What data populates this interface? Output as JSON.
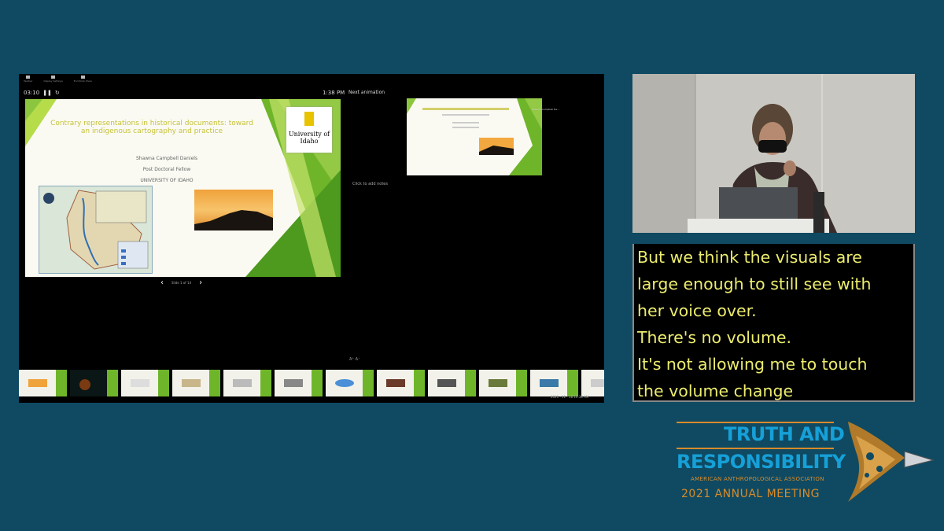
{
  "presenter": {
    "toolbar": [
      {
        "label": "Taskbar",
        "icon": "taskbar-icon"
      },
      {
        "label": "Display Settings",
        "icon": "display-settings-icon"
      },
      {
        "label": "End Slide Show",
        "icon": "end-slideshow-icon"
      }
    ],
    "timer": "03:10",
    "clock": "1:38 PM",
    "next_animation_label": "Next animation",
    "notes_placeholder": "Click to add notes",
    "slide_counter": "Slide 1 of 14",
    "prev_glyph": "‹",
    "next_glyph": "›",
    "font_adjust": "A⁺  A⁻",
    "next_slide_caption": "Shawna Campbell Da...",
    "status_text": "2021 · 11 · 18  10:38 AM"
  },
  "current_slide": {
    "title": "Contrary representations in historical documents: toward an indigenous cartography and practice",
    "author_lines": [
      "Shawna Campbell Daniels",
      "Post Doctoral Fellow",
      "UNIVERSITY OF IDAHO"
    ],
    "logo_text": "University of Idaho"
  },
  "captions": {
    "lines": [
      "But we think the visuals are",
      "large enough to still see with",
      "her voice over.",
      "There's no volume.",
      "It's not allowing me to touch",
      "the volume change"
    ]
  },
  "logo": {
    "line1": "TRUTH AND",
    "line2": "RESPONSIBILITY",
    "line3": "AMERICAN ANTHROPOLOGICAL ASSOCIATION",
    "line4": "2021 ANNUAL MEETING"
  },
  "colors": {
    "background": "#0f4a62",
    "caption_text": "#ecec6e",
    "logo_blue": "#16a0d8",
    "logo_orange": "#d88a2a",
    "slide_green": "#6fb52a"
  }
}
